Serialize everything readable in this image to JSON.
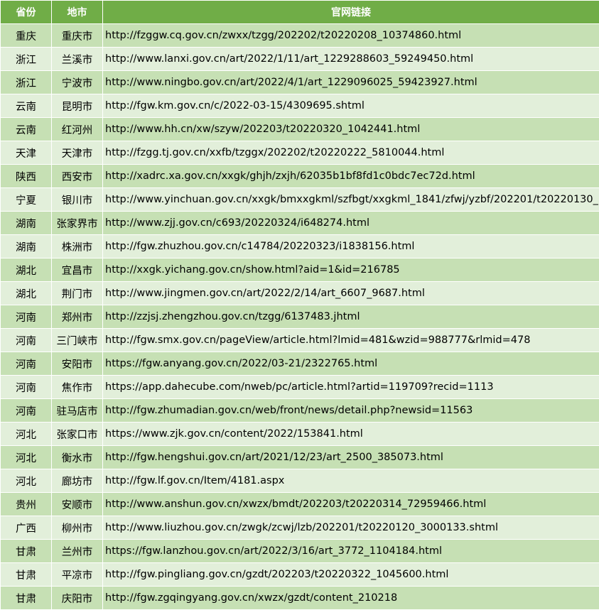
{
  "table": {
    "headers": [
      "省份",
      "地市",
      "官网链接"
    ],
    "rows": [
      {
        "province": "重庆",
        "city": "重庆市",
        "url": "http://fzggw.cq.gov.cn/zwxx/tzgg/202202/t20220208_10374860.html"
      },
      {
        "province": "浙江",
        "city": "兰溪市",
        "url": "http://www.lanxi.gov.cn/art/2022/1/11/art_1229288603_59249450.html"
      },
      {
        "province": "浙江",
        "city": "宁波市",
        "url": "http://www.ningbo.gov.cn/art/2022/4/1/art_1229096025_59423927.html"
      },
      {
        "province": "云南",
        "city": "昆明市",
        "url": "http://fgw.km.gov.cn/c/2022-03-15/4309695.shtml"
      },
      {
        "province": "云南",
        "city": "红河州",
        "url": "http://www.hh.cn/xw/szyw/202203/t20220320_1042441.html"
      },
      {
        "province": "天津",
        "city": "天津市",
        "url": "http://fzgg.tj.gov.cn/xxfb/tzggx/202202/t20220222_5810044.html"
      },
      {
        "province": "陕西",
        "city": "西安市",
        "url": "http://xadrc.xa.gov.cn/xxgk/ghjh/zxjh/62035b1bf8fd1c0bdc7ec72d.html"
      },
      {
        "province": "宁夏",
        "city": "银川市",
        "url": "http://www.yinchuan.gov.cn/xxgk/bmxxgkml/szfbgt/xxgkml_1841/zfwj/yzbf/202201/t20220130_"
      },
      {
        "province": "湖南",
        "city": "张家界市",
        "url": "http://www.zjj.gov.cn/c693/20220324/i648274.html"
      },
      {
        "province": "湖南",
        "city": "株洲市",
        "url": "http://fgw.zhuzhou.gov.cn/c14784/20220323/i1838156.html"
      },
      {
        "province": "湖北",
        "city": "宜昌市",
        "url": "http://xxgk.yichang.gov.cn/show.html?aid=1&id=216785"
      },
      {
        "province": "湖北",
        "city": "荆门市",
        "url": "http://www.jingmen.gov.cn/art/2022/2/14/art_6607_9687.html"
      },
      {
        "province": "河南",
        "city": "郑州市",
        "url": "http://zzjsj.zhengzhou.gov.cn/tzgg/6137483.jhtml"
      },
      {
        "province": "河南",
        "city": "三门峡市",
        "url": "http://fgw.smx.gov.cn/pageView/article.html?lmid=481&wzid=988777&rlmid=478"
      },
      {
        "province": "河南",
        "city": "安阳市",
        "url": "https://fgw.anyang.gov.cn/2022/03-21/2322765.html"
      },
      {
        "province": "河南",
        "city": "焦作市",
        "url": "https://app.dahecube.com/nweb/pc/article.html?artid=119709?recid=1113"
      },
      {
        "province": "河南",
        "city": "驻马店市",
        "url": "http://fgw.zhumadian.gov.cn/web/front/news/detail.php?newsid=11563"
      },
      {
        "province": "河北",
        "city": "张家口市",
        "url": "https://www.zjk.gov.cn/content/2022/153841.html"
      },
      {
        "province": "河北",
        "city": "衡水市",
        "url": "http://fgw.hengshui.gov.cn/art/2021/12/23/art_2500_385073.html"
      },
      {
        "province": "河北",
        "city": "廊坊市",
        "url": "http://fgw.lf.gov.cn/Item/4181.aspx"
      },
      {
        "province": "贵州",
        "city": "安顺市",
        "url": "http://www.anshun.gov.cn/xwzx/bmdt/202203/t20220314_72959466.html"
      },
      {
        "province": "广西",
        "city": "柳州市",
        "url": "http://www.liuzhou.gov.cn/zwgk/zcwj/lzb/202201/t20220120_3000133.shtml"
      },
      {
        "province": "甘肃",
        "city": "兰州市",
        "url": "https://fgw.lanzhou.gov.cn/art/2022/3/16/art_3772_1104184.html"
      },
      {
        "province": "甘肃",
        "city": "平凉市",
        "url": "http://fgw.pingliang.gov.cn/gzdt/202203/t20220322_1045600.html"
      },
      {
        "province": "甘肃",
        "city": "庆阳市",
        "url": "http://fgw.zgqingyang.gov.cn/xwzx/gzdt/content_210218"
      }
    ]
  },
  "colors": {
    "header_bg": "#70ad47",
    "row_odd_bg": "#c6e0b4",
    "row_even_bg": "#e2efda"
  }
}
